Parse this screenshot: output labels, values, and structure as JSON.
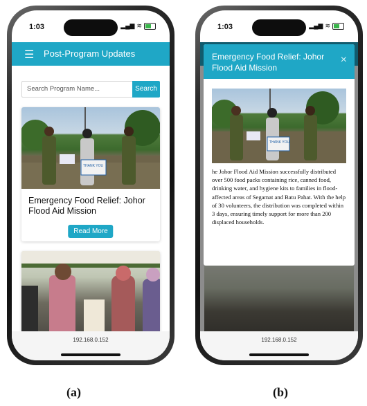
{
  "status": {
    "time": "1:03"
  },
  "app": {
    "title": "Post-Program Updates"
  },
  "search": {
    "placeholder": "Search Program Name...",
    "button": "Search"
  },
  "card": {
    "title": "Emergency Food Relief: Johor Flood Aid Mission",
    "read_more": "Read More"
  },
  "photo_text": {
    "sign": "THANK YOU"
  },
  "browser": {
    "url": "192.168.0.152"
  },
  "modal": {
    "title": "Emergency Food Relief: Johor Flood Aid Mission",
    "close": "×",
    "body": "he Johor Flood Aid Mission successfully distributed over 500 food packs containing rice, canned food, drinking water, and hygiene kits to families in flood-affected areas of Segamat and Batu Pahat. With the help of 30 volunteers, the distribution was completed within 3 days, ensuring timely support for more than 200 displaced households."
  },
  "labels": {
    "a": "(a)",
    "b": "(b)"
  },
  "colors": {
    "accent": "#1fa7c6"
  }
}
